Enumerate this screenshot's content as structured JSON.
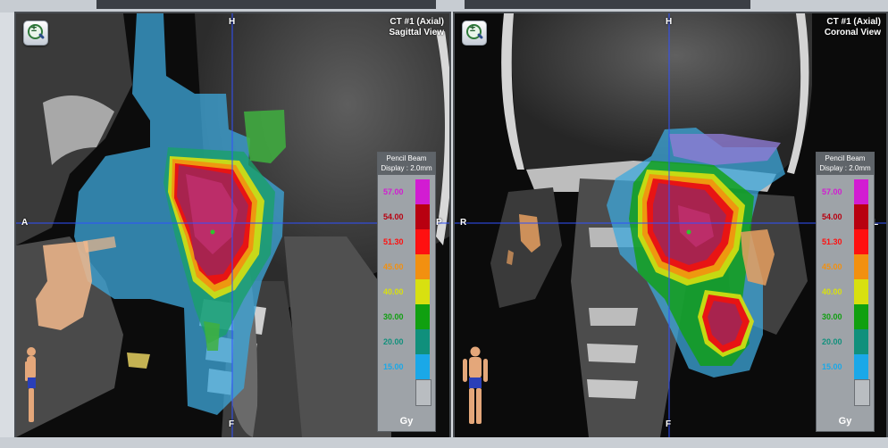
{
  "views": [
    {
      "title_line1": "CT #1 (Axial)",
      "title_line2": "Sagittal View",
      "dir_top": "H",
      "dir_left": "A",
      "dir_right": "P",
      "dir_bottom": "F"
    },
    {
      "title_line1": "CT #1 (Axial)",
      "title_line2": "Coronal View",
      "dir_top": "H",
      "dir_left": "R",
      "dir_right": "L",
      "dir_bottom": "F"
    }
  ],
  "legend": {
    "header_line1": "Pencil Beam",
    "header_line2": "Display : 2.0mm",
    "unit": "Gy",
    "levels": [
      {
        "value": "57.00",
        "color": "#d21cd2"
      },
      {
        "value": "54.00",
        "color": "#b80010"
      },
      {
        "value": "51.30",
        "color": "#ff1010"
      },
      {
        "value": "45.00",
        "color": "#f29010"
      },
      {
        "value": "40.00",
        "color": "#d8e010"
      },
      {
        "value": "30.00",
        "color": "#10a010"
      },
      {
        "value": "20.00",
        "color": "#10907c"
      },
      {
        "value": "15.00",
        "color": "#1aa8e8"
      }
    ]
  },
  "icons": [
    "zoom-magnifier-icon",
    "patient-orientation-figure-icon"
  ]
}
